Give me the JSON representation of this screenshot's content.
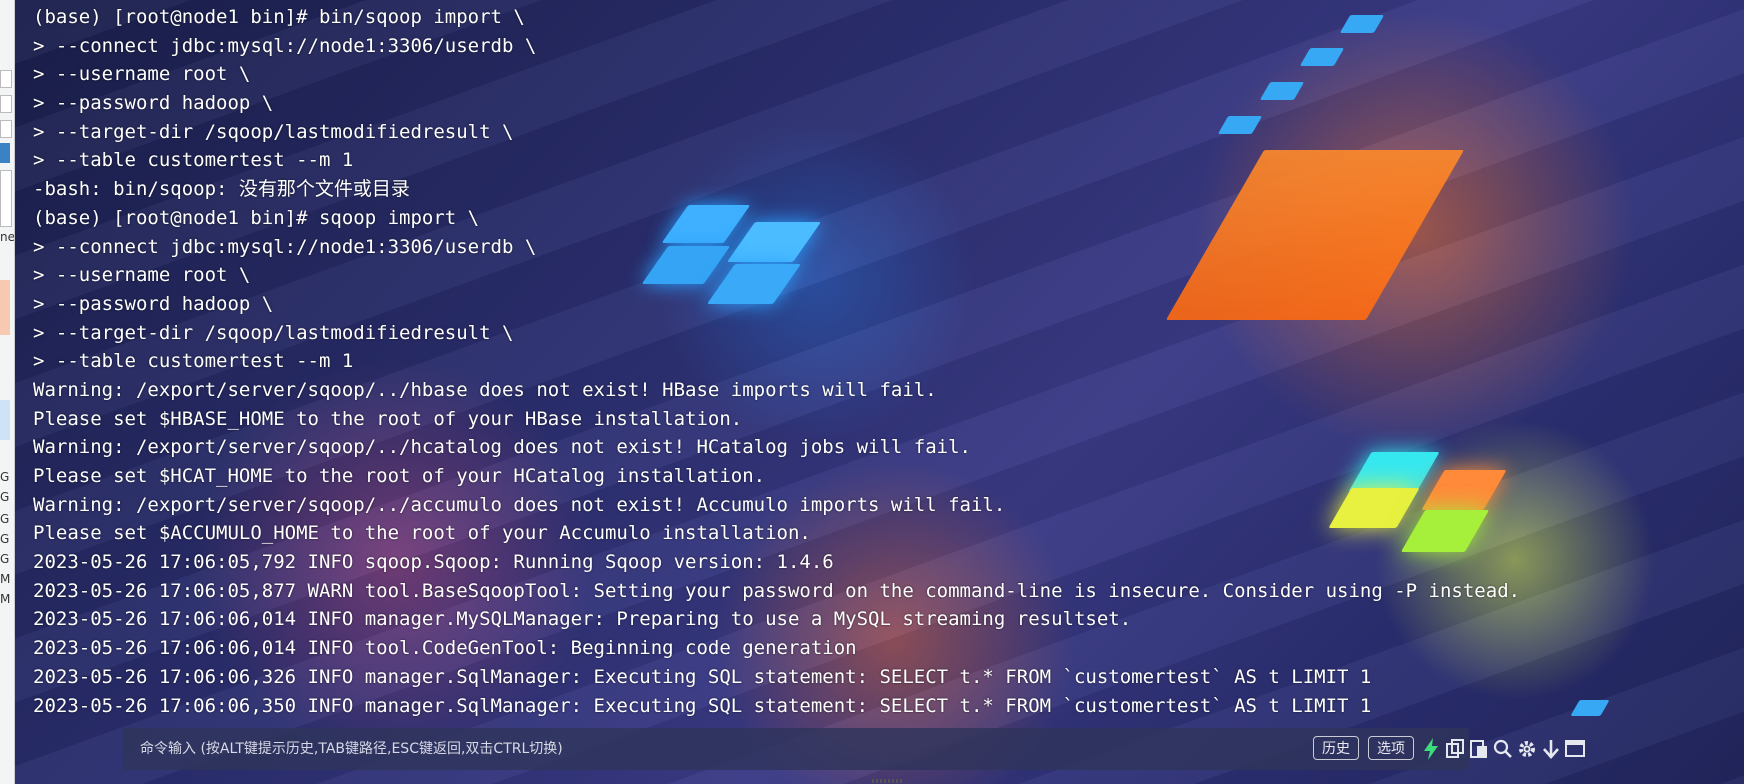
{
  "terminal": {
    "lines": [
      "(base) [root@node1 bin]# bin/sqoop import \\",
      "> --connect jdbc:mysql://node1:3306/userdb \\",
      "> --username root \\",
      "> --password hadoop \\",
      "> --target-dir /sqoop/lastmodifiedresult \\",
      "> --table customertest --m 1",
      "-bash: bin/sqoop: 没有那个文件或目录",
      "(base) [root@node1 bin]# sqoop import \\",
      "> --connect jdbc:mysql://node1:3306/userdb \\",
      "> --username root \\",
      "> --password hadoop \\",
      "> --target-dir /sqoop/lastmodifiedresult \\",
      "> --table customertest --m 1",
      "Warning: /export/server/sqoop/../hbase does not exist! HBase imports will fail.",
      "Please set $HBASE_HOME to the root of your HBase installation.",
      "Warning: /export/server/sqoop/../hcatalog does not exist! HCatalog jobs will fail.",
      "Please set $HCAT_HOME to the root of your HCatalog installation.",
      "Warning: /export/server/sqoop/../accumulo does not exist! Accumulo imports will fail.",
      "Please set $ACCUMULO_HOME to the root of your Accumulo installation.",
      "2023-05-26 17:06:05,792 INFO sqoop.Sqoop: Running Sqoop version: 1.4.6",
      "2023-05-26 17:06:05,877 WARN tool.BaseSqoopTool: Setting your password on the command-line is insecure. Consider using -P instead.",
      "2023-05-26 17:06:06,014 INFO manager.MySQLManager: Preparing to use a MySQL streaming resultset.",
      "2023-05-26 17:06:06,014 INFO tool.CodeGenTool: Beginning code generation",
      "2023-05-26 17:06:06,326 INFO manager.SqlManager: Executing SQL statement: SELECT t.* FROM `customertest` AS t LIMIT 1",
      "2023-05-26 17:06:06,350 INFO manager.SqlManager: Executing SQL statement: SELECT t.* FROM `customertest` AS t LIMIT 1"
    ]
  },
  "command_bar": {
    "placeholder": "命令输入 (按ALT键提示历史,TAB键路径,ESC键返回,双击CTRL切换)",
    "history_label": "历史",
    "options_label": "选项",
    "icons": [
      "lightning-icon",
      "copy-icon",
      "paste-icon",
      "search-icon",
      "gear-icon",
      "arrow-down-icon",
      "window-icon"
    ]
  },
  "left_strip_fragments": [
    "ne",
    "G",
    "G",
    "G",
    "G",
    "G",
    "M",
    "M"
  ],
  "colors": {
    "terminal_text": "#ffffff",
    "accent_lightning": "#3ddc7a"
  }
}
